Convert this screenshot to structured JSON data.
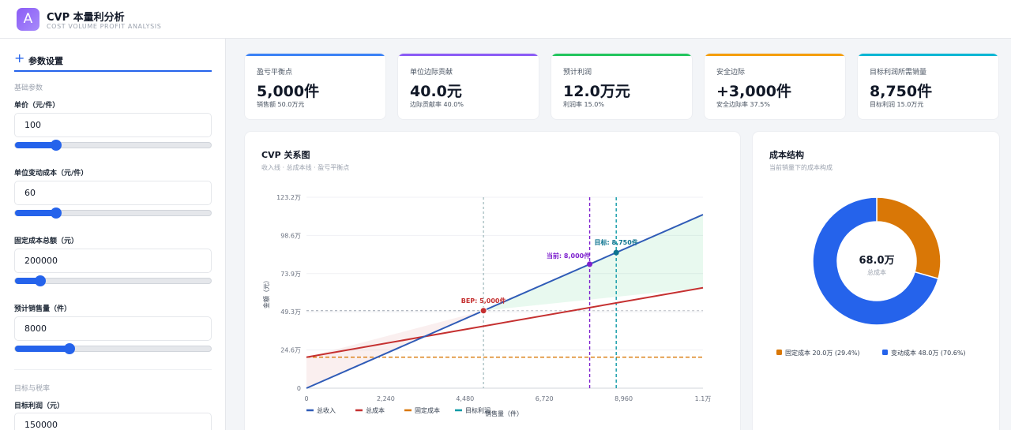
{
  "app": {
    "logo_letter": "A",
    "title": "CVP 本量利分析",
    "subtitle": "COST VOLUME PROFIT ANALYSIS"
  },
  "sidebar": {
    "title": "参数设置",
    "section_basic": "基础参数",
    "section_target": "目标与税率",
    "fields": [
      {
        "label": "单价（元/件）",
        "value": "100",
        "slider_fraction": 0.21
      },
      {
        "label": "单位变动成本（元/件）",
        "value": "60",
        "slider_fraction": 0.21
      },
      {
        "label": "固定成本总额（元）",
        "value": "200000",
        "slider_fraction": 0.13
      },
      {
        "label": "预计销售量（件）",
        "value": "8000",
        "slider_fraction": 0.28
      },
      {
        "label": "目标利润（元）",
        "value": "150000"
      }
    ]
  },
  "kpis": [
    {
      "label": "盈亏平衡点",
      "value": "5,000件",
      "sub": "销售额 50.0万元",
      "color": "#3b82f6"
    },
    {
      "label": "单位边际贡献",
      "value": "40.0元",
      "sub": "边际贡献率 40.0%",
      "color": "#8b5cf6"
    },
    {
      "label": "预计利润",
      "value": "12.0万元",
      "sub": "利润率 15.0%",
      "color": "#22c55e"
    },
    {
      "label": "安全边际",
      "value": "+3,000件",
      "sub": "安全边际率 37.5%",
      "color": "#f59e0b"
    },
    {
      "label": "目标利润所需销量",
      "value": "8,750件",
      "sub": "目标利润 15.0万元",
      "color": "#06b6d4"
    }
  ],
  "cvp_panel": {
    "title": "CVP 关系图",
    "subtitle": "收入线 · 总成本线 · 盈亏平衡点"
  },
  "cost_panel": {
    "title": "成本结构",
    "subtitle": "当前销量下的成本构成"
  },
  "chart_data": [
    {
      "type": "line",
      "title": "CVP 关系图",
      "xlabel": "销售量（件）",
      "ylabel": "金额（元）",
      "xlim": [
        0,
        11200
      ],
      "ylim": [
        0,
        1232000
      ],
      "x_ticks": [
        "0",
        "2,240",
        "4,480",
        "6,720",
        "8,960",
        "1.1万"
      ],
      "y_ticks": [
        "0",
        "24.6万",
        "49.3万",
        "73.9万",
        "98.6万",
        "123.2万"
      ],
      "series": [
        {
          "name": "总收入",
          "color": "#2f5bb7",
          "x": [
            0,
            11200
          ],
          "y": [
            0,
            1120000
          ]
        },
        {
          "name": "总成本",
          "color": "#c53030",
          "x": [
            0,
            11200
          ],
          "y": [
            200000,
            648000
          ]
        },
        {
          "name": "固定成本",
          "color": "#d97706",
          "x": [
            0,
            11200
          ],
          "y": [
            200000,
            200000
          ]
        },
        {
          "name": "目标利润",
          "color": "#0e9aa7",
          "x": [
            8750,
            8750
          ],
          "y": [
            0,
            1232000
          ]
        }
      ],
      "markers": [
        {
          "label": "BEP: 5,000件",
          "x": 5000,
          "y": 500000,
          "color": "#c53030"
        },
        {
          "label": "当前: 8,000件",
          "x": 8000,
          "y": 800000,
          "color": "#7e22ce"
        },
        {
          "label": "目标: 8,750件",
          "x": 8750,
          "y": 875000,
          "color": "#0e7490"
        }
      ],
      "legend_placement": "bottom"
    },
    {
      "type": "pie",
      "title": "成本结构",
      "center_value": "68.0万",
      "center_label": "总成本",
      "slices": [
        {
          "name": "固定成本",
          "value": 20.0,
          "label": "固定成本 20.0万 (29.4%)",
          "color": "#d97706"
        },
        {
          "name": "变动成本",
          "value": 48.0,
          "label": "变动成本 48.0万 (70.6%)",
          "color": "#2563eb"
        }
      ],
      "legend_placement": "bottom"
    }
  ]
}
